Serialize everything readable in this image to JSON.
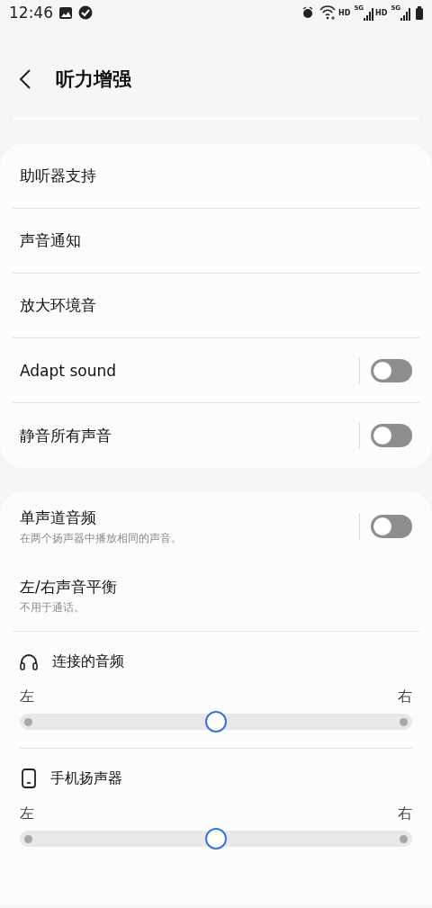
{
  "status_bar": {
    "time": "12:46",
    "network": [
      {
        "label": "HD",
        "tech": "5G"
      },
      {
        "label": "HD",
        "tech": "5G"
      }
    ]
  },
  "header": {
    "title": "听力增强"
  },
  "main_card": {
    "rows": [
      {
        "kind": "link",
        "label": "助听器支持"
      },
      {
        "kind": "link",
        "label": "声音通知"
      },
      {
        "kind": "link",
        "label": "放大环境音"
      },
      {
        "kind": "switch",
        "label": "Adapt sound",
        "on": false
      },
      {
        "kind": "switch",
        "label": "静音所有声音",
        "on": false
      }
    ]
  },
  "audio_card": {
    "rows": [
      {
        "kind": "switch",
        "label": "单声道音频",
        "description": "在两个扬声器中播放相同的声音。",
        "on": false
      },
      {
        "kind": "link",
        "label": "左/右声音平衡",
        "description": "不用于通话。"
      }
    ],
    "balances": [
      {
        "kind": "headphones",
        "label": "连接的音频",
        "left": "左",
        "right": "右",
        "level": 0.5
      },
      {
        "kind": "phone",
        "label": "手机扬声器",
        "left": "左",
        "right": "右",
        "level": 0.5
      }
    ]
  }
}
